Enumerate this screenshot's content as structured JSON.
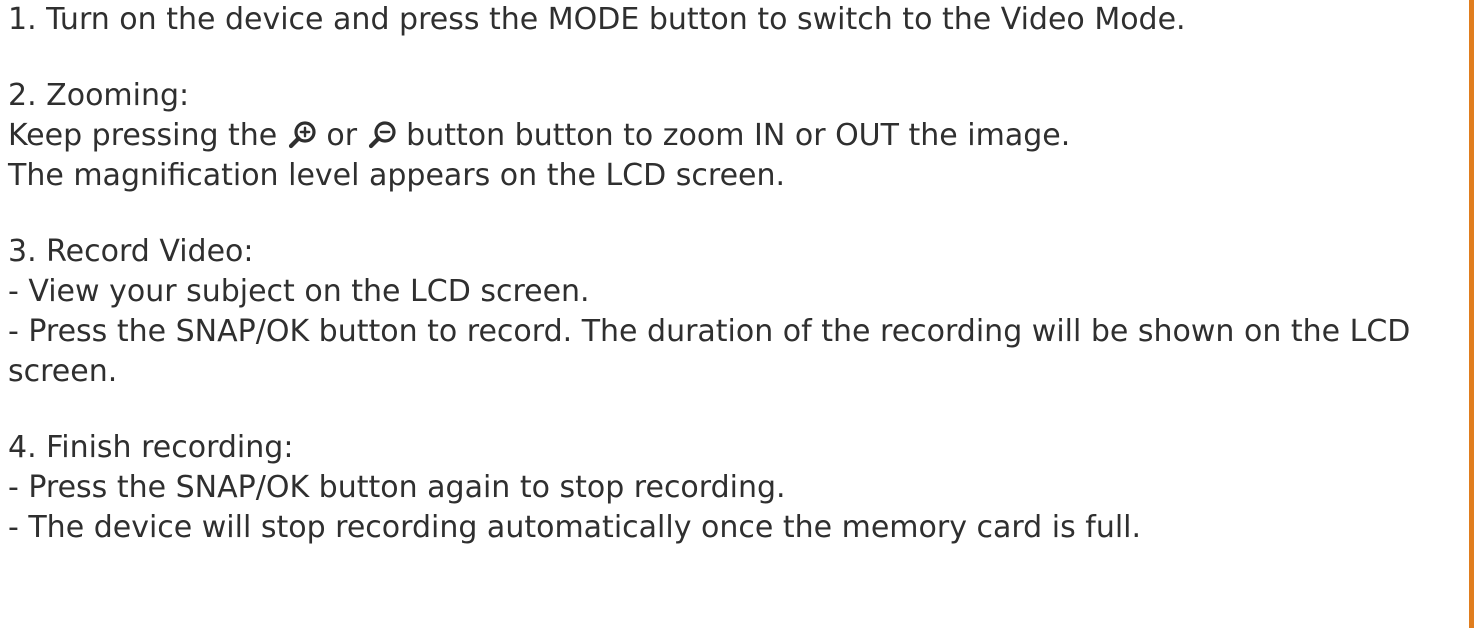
{
  "theme": {
    "text_color": "#2f2f2f",
    "accent_color": "#e07d1e"
  },
  "step1": {
    "text": "1. Turn on the device and press the MODE button to switch to the Video Mode."
  },
  "step2": {
    "heading": "2. Zooming:",
    "line1_before": "Keep pressing the",
    "zoom_in_icon": "zoom-in-icon",
    "line1_middle": "or",
    "zoom_out_icon": "zoom-out-icon",
    "line1_after": "button button to zoom IN or OUT the image.",
    "line2": "The magnification level appears on the LCD screen."
  },
  "step3": {
    "heading": "3. Record Video:",
    "bullet1": "- View your subject on the LCD screen.",
    "bullet2": "- Press the SNAP/OK button to record. The duration of the recording will be shown on the LCD screen."
  },
  "step4": {
    "heading": "4. Finish recording:",
    "bullet1": "- Press the SNAP/OK button again to stop recording.",
    "bullet2": "- The device will stop recording automatically once the memory card is full."
  }
}
